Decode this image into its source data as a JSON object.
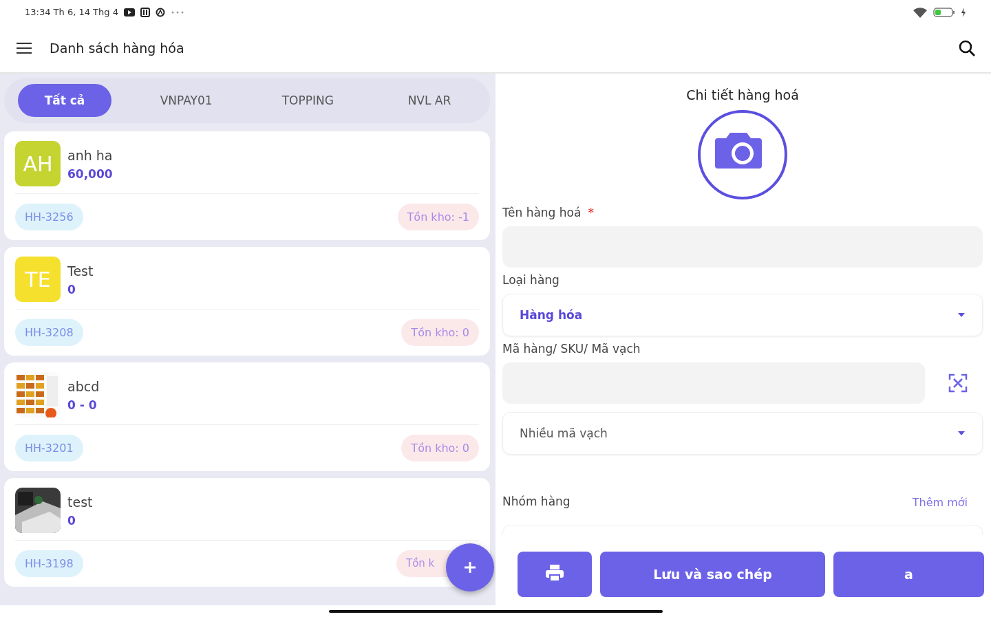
{
  "status_bar": {
    "time": "13:34 Th 6, 14 Thg 4"
  },
  "app_bar": {
    "title": "Danh sách hàng hóa"
  },
  "tabs": [
    {
      "label": "Tất cả",
      "selected": true
    },
    {
      "label": "VNPAY01",
      "selected": false
    },
    {
      "label": "TOPPING",
      "selected": false
    },
    {
      "label": "NVL AR",
      "selected": false
    }
  ],
  "products": [
    {
      "avatar": {
        "kind": "initials",
        "text": "AH",
        "color": "#c5d430"
      },
      "name": "anh ha",
      "price": "60,000",
      "code": "HH-3256",
      "stock": "Tồn kho: -1"
    },
    {
      "avatar": {
        "kind": "initials",
        "text": "TE",
        "color": "#f5e02e"
      },
      "name": "Test",
      "price": "0",
      "code": "HH-3208",
      "stock": "Tồn kho: 0"
    },
    {
      "name": "abcd",
      "price": "0 - 0",
      "code": "HH-3201",
      "stock": "Tồn kho: 0"
    },
    {
      "name": "test",
      "price": "0",
      "code": "HH-3198",
      "stock": "Tồn k"
    }
  ],
  "detail": {
    "title": "Chi tiết hàng hoá",
    "name_label": "Tên hàng hoá",
    "required_mark": "*",
    "type_label": "Loại hàng",
    "type_value": "Hàng hóa",
    "sku_label": "Mã hàng/ SKU/ Mã vạch",
    "multi_barcode": "Nhiều mã vạch",
    "group_label": "Nhóm hàng",
    "group_add": "Thêm mới"
  },
  "actions": {
    "save_copy": "Lưu và sao chép",
    "save": "a"
  }
}
